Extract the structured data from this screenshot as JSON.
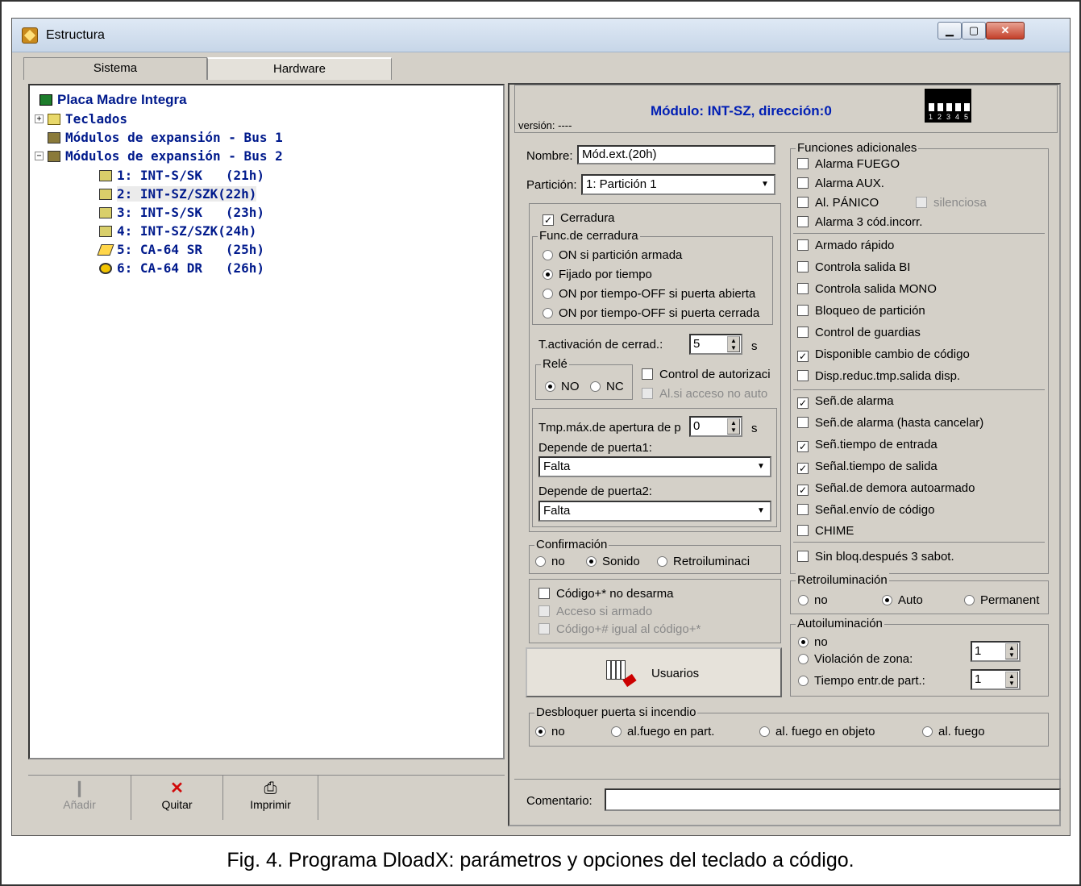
{
  "window": {
    "title": "Estructura"
  },
  "tabs": [
    "Sistema",
    "Hardware"
  ],
  "tree": {
    "root": "Placa Madre Integra",
    "items": [
      "Teclados",
      "Módulos de expansión - Bus 1",
      "Módulos de expansión - Bus 2"
    ],
    "modules": [
      "1: INT-S/SK   (21h)",
      "2: INT-SZ/SZK(22h)",
      "3: INT-S/SK   (23h)",
      "4: INT-SZ/SZK(24h)",
      "5: CA-64 SR   (25h)",
      "6: CA-64 DR   (26h)"
    ]
  },
  "bottom_buttons": {
    "add": "Añadir",
    "remove": "Quitar",
    "print": "Imprimir"
  },
  "header": {
    "title": "Módulo: INT-SZ, dirección:0",
    "version": "versión: ----",
    "dip_labels": [
      "1",
      "2",
      "3",
      "4",
      "5"
    ]
  },
  "form": {
    "nombre_label": "Nombre:",
    "nombre_value": "Mód.ext.(20h)",
    "particion_label": "Partición:",
    "particion_value": "1: Partición  1",
    "cerradura": "Cerradura",
    "func_title": "Func.de cerradura",
    "func_options": [
      "ON si partición armada",
      "Fijado por tiempo",
      "ON por tiempo-OFF si puerta abierta",
      "ON por tiempo-OFF si puerta cerrada"
    ],
    "t_activacion_label": "T.activación de cerrad.:",
    "t_activacion_value": "5",
    "t_unit": "s",
    "rele_title": "Relé",
    "rele_no": "NO",
    "rele_nc": "NC",
    "control_autorizaci": "Control de autorizaci",
    "al_si_acceso": "Al.si acceso no auto",
    "tmp_max_label": "Tmp.máx.de apertura de p",
    "tmp_max_value": "0",
    "tmp_unit": "s",
    "depende1_label": "Depende de puerta1:",
    "depende1_value": "Falta",
    "depende2_label": "Depende de puerta2:",
    "depende2_value": "Falta",
    "confirmacion_title": "Confirmación",
    "conf_options": [
      "no",
      "Sonido",
      "Retroiluminaci"
    ],
    "codigo_no_desarma": "Código+* no desarma",
    "acceso_si_armado": "Acceso si armado",
    "codigo_igual": "Código+# igual al código+*",
    "usuarios": "Usuarios"
  },
  "funciones": {
    "title": "Funciones adicionales",
    "alarma_fuego": "Alarma FUEGO",
    "alarma_aux": "Alarma AUX.",
    "al_panico": "Al. PÁNICO",
    "silenciosa": "silenciosa",
    "alarma_3": "Alarma 3 cód.incorr.",
    "group2": [
      {
        "label": "Armado rápido",
        "checked": false
      },
      {
        "label": "Controla salida BI",
        "checked": false
      },
      {
        "label": "Controla salida MONO",
        "checked": false
      },
      {
        "label": "Bloqueo de partición",
        "checked": false
      },
      {
        "label": "Control de guardias",
        "checked": false
      },
      {
        "label": "Disponible cambio de código",
        "checked": true
      },
      {
        "label": "Disp.reduc.tmp.salida disp.",
        "checked": false
      }
    ],
    "group3": [
      {
        "label": "Señ.de alarma",
        "checked": true
      },
      {
        "label": "Señ.de alarma (hasta cancelar)",
        "checked": false
      },
      {
        "label": "Señ.tiempo de entrada",
        "checked": true
      },
      {
        "label": "Señal.tiempo de salida",
        "checked": true
      },
      {
        "label": "Señal.de demora autoarmado",
        "checked": true
      },
      {
        "label": "Señal.envío de código",
        "checked": false
      },
      {
        "label": "CHIME",
        "checked": false
      }
    ],
    "sin_bloq": "Sin bloq.después 3 sabot."
  },
  "retro": {
    "title": "Retroiluminación",
    "options": [
      "no",
      "Auto",
      "Permanent"
    ]
  },
  "auto": {
    "title": "Autoiluminación",
    "no": "no",
    "violacion": "Violación de zona:",
    "violacion_value": "1",
    "tiempo": "Tiempo entr.de part.:",
    "tiempo_value": "1"
  },
  "desbloq": {
    "title": "Desbloquer puerta si incendio",
    "options": [
      "no",
      "al.fuego en part.",
      "al. fuego en objeto",
      "al. fuego"
    ]
  },
  "comentario": {
    "label": "Comentario:",
    "value": ""
  },
  "caption": "Fig. 4. Programa DloadX: parámetros y opciones del teclado a código."
}
